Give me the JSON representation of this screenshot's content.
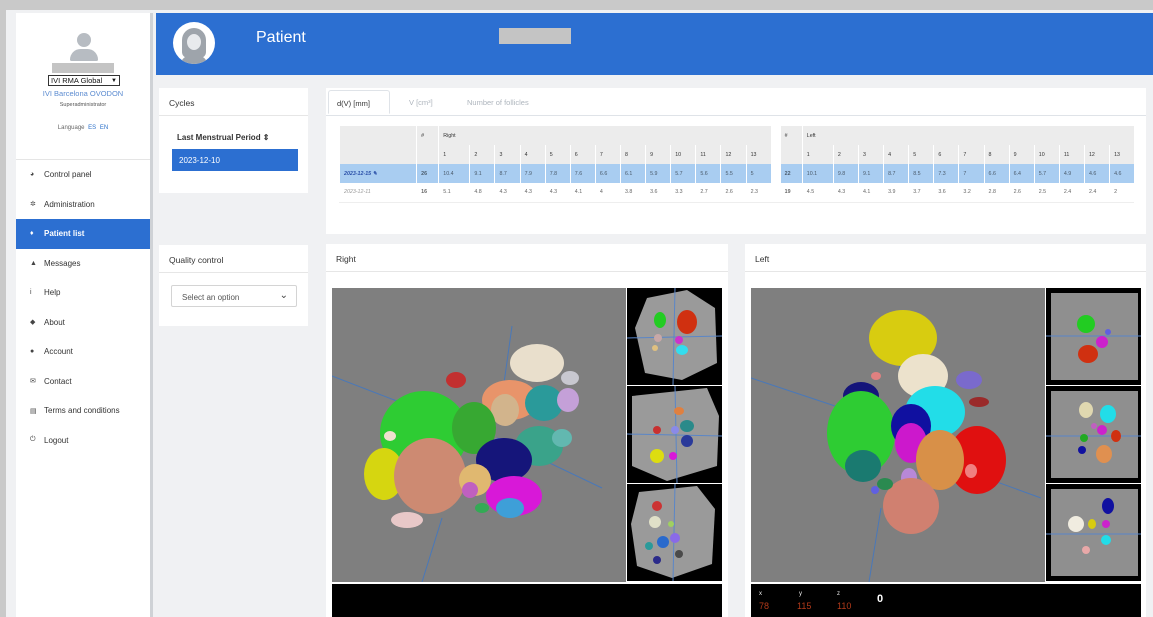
{
  "sidebar": {
    "org_select": "IVI RMA Global",
    "org_name": "IVI Barcelona OVODON",
    "role": "Superadministrator",
    "language_label": "Language",
    "languages": [
      "ES",
      "EN"
    ],
    "nav": [
      {
        "label": "Control panel",
        "icon": "dashboard-icon"
      },
      {
        "label": "Administration",
        "icon": "gear-icon"
      },
      {
        "label": "Patient list",
        "icon": "patient-icon",
        "active": true
      },
      {
        "label": "Messages",
        "icon": "warning-icon"
      },
      {
        "label": "Help",
        "icon": "info-icon"
      },
      {
        "label": "About",
        "icon": "tag-icon"
      },
      {
        "label": "Account",
        "icon": "user-icon"
      },
      {
        "label": "Contact",
        "icon": "envelope-icon"
      },
      {
        "label": "Terms and conditions",
        "icon": "document-icon"
      },
      {
        "label": "Logout",
        "icon": "power-icon"
      }
    ]
  },
  "header": {
    "title": "Patient"
  },
  "cycles": {
    "title": "Cycles",
    "lmp_label": "Last Menstrual Period ⇕",
    "cycle": "2023-12-10"
  },
  "quality": {
    "title": "Quality control",
    "placeholder": "Select an option"
  },
  "results": {
    "tabs": [
      "d(V) [mm]",
      "V [cm³]",
      "Number of follicles"
    ],
    "active_tab": 0,
    "table": {
      "hash": "#",
      "right_label": "Right",
      "left_label": "Left",
      "right_cols": [
        "1",
        "2",
        "3",
        "4",
        "5",
        "6",
        "7",
        "8",
        "9",
        "10",
        "11",
        "12",
        "13"
      ],
      "left_cols": [
        "1",
        "2",
        "3",
        "4",
        "5",
        "6",
        "7",
        "8",
        "9",
        "10",
        "11",
        "12",
        "13"
      ],
      "rows": [
        {
          "date": "2023-12-15 ✎",
          "selected": true,
          "right_count": "26",
          "right": [
            "10.4",
            "9.1",
            "8.7",
            "7.9",
            "7.8",
            "7.6",
            "6.6",
            "6.1",
            "5.9",
            "5.7",
            "5.6",
            "5.5",
            "5"
          ],
          "left_count": "22",
          "left": [
            "10.1",
            "9.8",
            "9.1",
            "8.7",
            "8.5",
            "7.3",
            "7",
            "6.6",
            "6.4",
            "5.7",
            "4.9",
            "4.6",
            "4.6"
          ]
        },
        {
          "date": "2023-12-11",
          "selected": false,
          "right_count": "16",
          "right": [
            "5.1",
            "4.8",
            "4.3",
            "4.3",
            "4.3",
            "4.1",
            "4",
            "3.8",
            "3.6",
            "3.3",
            "2.7",
            "2.6",
            "2.3"
          ],
          "left_count": "19",
          "left": [
            "4.5",
            "4.3",
            "4.1",
            "3.9",
            "3.7",
            "3.6",
            "3.2",
            "2.8",
            "2.6",
            "2.5",
            "2.4",
            "2.4",
            "2"
          ]
        }
      ]
    }
  },
  "viewers": {
    "right_title": "Right",
    "left_title": "Left",
    "coords": {
      "x_label": "x",
      "y_label": "y",
      "z_label": "z",
      "x": "78",
      "y": "115",
      "z": "110",
      "extra": "0"
    }
  },
  "colors": {
    "accent": "#2c6fd1",
    "selected_row": "#a9cdf1"
  }
}
